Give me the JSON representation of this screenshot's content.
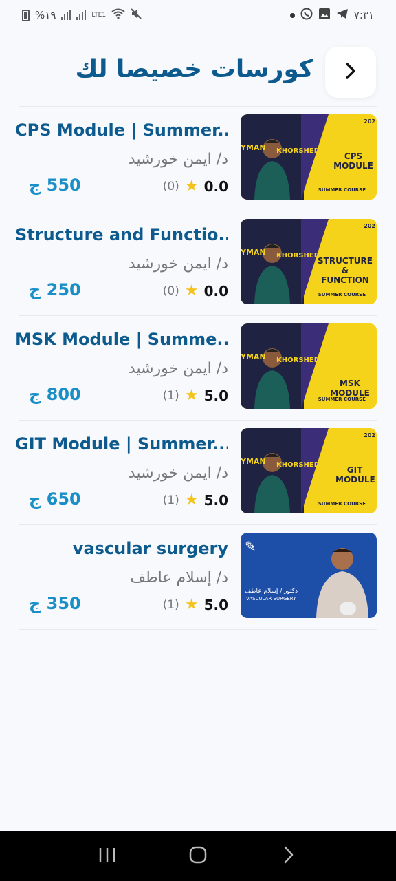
{
  "status_bar": {
    "time": "٧:٣١",
    "battery": "%١٩",
    "network": "LTE1"
  },
  "header": {
    "title": "كورسات خصيصا لك",
    "back_icon": "chevron-right-icon"
  },
  "courses": [
    {
      "title": "CPS Module | Summer...",
      "instructor": "د/ ايمن خورشيد",
      "rating": "0.0",
      "count": "(0)",
      "price": "550 ج",
      "thumb_label": "CPS MODULE",
      "thumb_style": "yellow"
    },
    {
      "title": "Structure and Functio...",
      "instructor": "د/ ايمن خورشيد",
      "rating": "0.0",
      "count": "(0)",
      "price": "250 ج",
      "thumb_label": "STRUCTURE & FUNCTION",
      "thumb_style": "yellow"
    },
    {
      "title": "MSK Module | Summe...",
      "instructor": "د/ ايمن خورشيد",
      "rating": "5.0",
      "count": "(1)",
      "price": "800 ج",
      "thumb_label": "MSK MODULE",
      "thumb_style": "yellow"
    },
    {
      "title": "GIT Module | Summer...",
      "instructor": "د/ ايمن خورشيد",
      "rating": "5.0",
      "count": "(1)",
      "price": "650 ج",
      "thumb_label": "GIT MODULE",
      "thumb_style": "yellow"
    },
    {
      "title": "vascular surgery",
      "instructor": "د/ إسلام عاطف",
      "rating": "5.0",
      "count": "(1)",
      "price": "350 ج",
      "thumb_label": "VASCULAR SURGERY",
      "thumb_style": "blue"
    }
  ],
  "thumb_common": {
    "name_left": "YMAN",
    "name_right": "KHORSHED",
    "sub": "SUMMER COURSE",
    "year": "202",
    "blue_name": "دكتور / إسلام عاطف"
  },
  "colors": {
    "title_blue": "#0d5a8f",
    "price_blue": "#1a8fc7",
    "star_yellow": "#f4c21b",
    "thumb_yellow": "#f5d31a",
    "thumb_blue": "#1e4fa8"
  },
  "nav_bar": {
    "recents_icon": "recents-icon",
    "home_icon": "home-icon",
    "back_icon": "back-icon"
  }
}
